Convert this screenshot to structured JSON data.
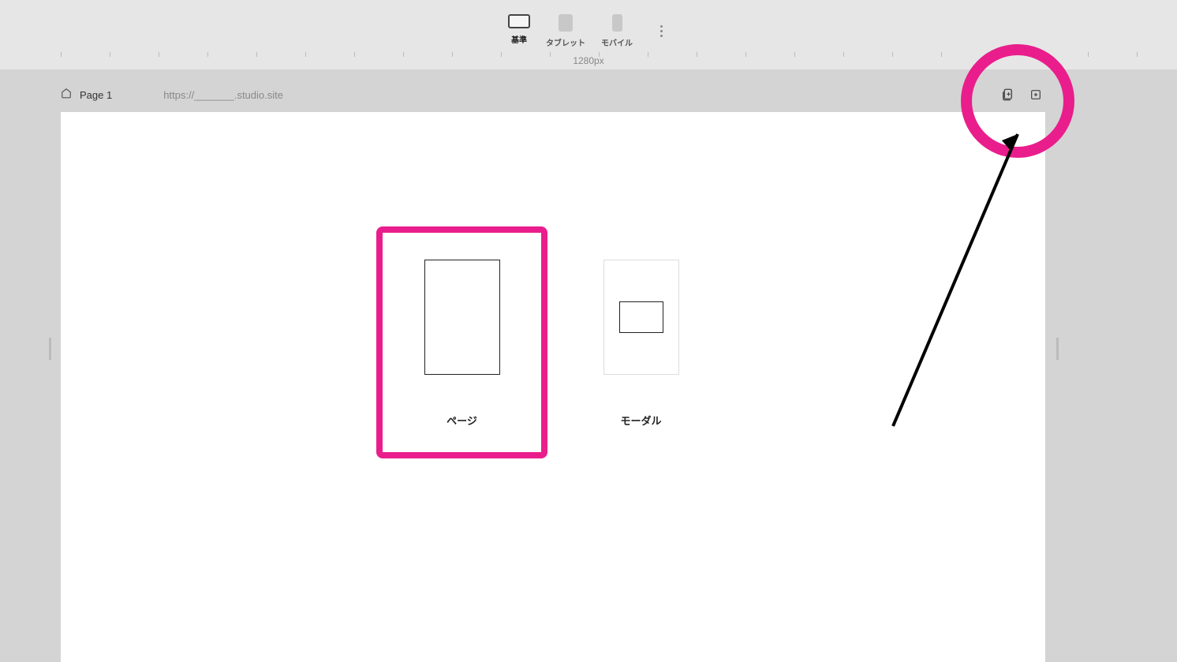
{
  "toolbar": {
    "devices": {
      "desktop": "基準",
      "tablet": "タブレット",
      "mobile": "モバイル"
    },
    "width_label": "1280px"
  },
  "page_header": {
    "page_name": "Page 1",
    "url": "https://_______.studio.site"
  },
  "dialog": {
    "cards": [
      {
        "label": "ページ",
        "type": "page",
        "selected": true
      },
      {
        "label": "モーダル",
        "type": "modal",
        "selected": false
      }
    ]
  },
  "annotation": {
    "highlight_color": "#e91e8c"
  }
}
